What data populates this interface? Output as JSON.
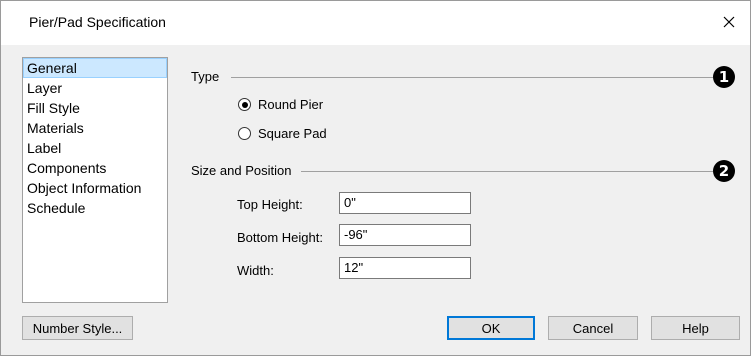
{
  "window": {
    "title": "Pier/Pad Specification",
    "close_icon": "close-icon"
  },
  "nav": {
    "items": [
      {
        "label": "General",
        "selected": true
      },
      {
        "label": "Layer"
      },
      {
        "label": "Fill Style"
      },
      {
        "label": "Materials"
      },
      {
        "label": "Label"
      },
      {
        "label": "Components"
      },
      {
        "label": "Object Information"
      },
      {
        "label": "Schedule"
      }
    ]
  },
  "type_group": {
    "label": "Type",
    "badge": "1",
    "options": [
      {
        "label": "Round Pier",
        "checked": true
      },
      {
        "label": "Square Pad",
        "checked": false
      }
    ]
  },
  "size_group": {
    "label": "Size and Position",
    "badge": "2",
    "fields": [
      {
        "label": "Top Height:",
        "value": "0\""
      },
      {
        "label": "Bottom Height:",
        "value": "-96\""
      },
      {
        "label": "Width:",
        "value": "12\""
      }
    ]
  },
  "buttons": {
    "number_style": "Number Style...",
    "ok": "OK",
    "cancel": "Cancel",
    "help": "Help"
  }
}
